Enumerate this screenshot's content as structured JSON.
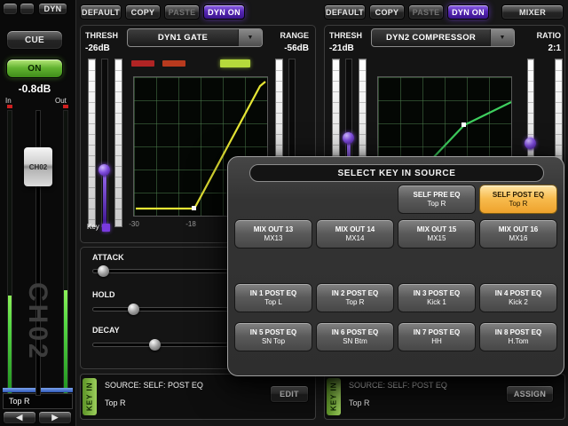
{
  "icons": {
    "prev": "◀",
    "next": "▶",
    "dropdown": "▼"
  },
  "colors": {
    "accent_purple": "#6a35c8",
    "on_green": "#5fae2e",
    "keyin_green": "#6fae35",
    "selected_orange": "#f2b94a",
    "channel_blue": "#4a78c8",
    "gate_curve": "#e6e635",
    "comp_curve": "#3ecf5e"
  },
  "channel": {
    "dyn_tab": "DYN",
    "cue": "CUE",
    "on": "ON",
    "level": "-0.8dB",
    "in_label": "In",
    "out_label": "Out",
    "fader_cap": "CH02",
    "name_vertical": "CH02",
    "patch": "Top R"
  },
  "dyn1": {
    "toolbar": {
      "default": "DEFAULT",
      "copy": "COPY",
      "paste": "PASTE",
      "dyn_on": "DYN ON"
    },
    "thresh_label": "THRESH",
    "thresh_value": "-26dB",
    "type": "DYN1 GATE",
    "range_label": "RANGE",
    "range_value": "-56dB",
    "axis_labels": [
      "-30",
      "-18"
    ],
    "key_label": "Key",
    "attack_label": "ATTACK",
    "hold_label": "HOLD",
    "decay_label": "DECAY",
    "keyin": {
      "tab": "KEY IN",
      "source": "SOURCE: SELF: POST EQ",
      "name": "Top R",
      "action": "EDIT"
    }
  },
  "dyn2": {
    "toolbar": {
      "default": "DEFAULT",
      "copy": "COPY",
      "paste": "PASTE",
      "dyn_on": "DYN ON",
      "mixer": "MIXER"
    },
    "thresh_label": "THRESH",
    "thresh_value": "-21dB",
    "type": "DYN2 COMPRESSOR",
    "ratio_label": "RATIO",
    "ratio_value": "2:1",
    "keyin": {
      "tab": "KEY IN",
      "source": "SOURCE: SELF: POST EQ",
      "name": "Top R",
      "action": "ASSIGN"
    }
  },
  "popup": {
    "title": "SELECT KEY IN SOURCE",
    "self_buttons": [
      {
        "l1": "SELF PRE EQ",
        "l2": "Top R",
        "selected": false
      },
      {
        "l1": "SELF POST EQ",
        "l2": "Top R",
        "selected": true
      }
    ],
    "mix_buttons": [
      {
        "l1": "MIX OUT 13",
        "l2": "MX13"
      },
      {
        "l1": "MIX OUT 14",
        "l2": "MX14"
      },
      {
        "l1": "MIX OUT 15",
        "l2": "MX15"
      },
      {
        "l1": "MIX OUT 16",
        "l2": "MX16"
      }
    ],
    "in_buttons": [
      {
        "l1": "IN 1 POST EQ",
        "l2": "Top L"
      },
      {
        "l1": "IN 2 POST EQ",
        "l2": "Top R"
      },
      {
        "l1": "IN 3 POST EQ",
        "l2": "Kick 1"
      },
      {
        "l1": "IN 4 POST EQ",
        "l2": "Kick 2"
      },
      {
        "l1": "IN 5 POST EQ",
        "l2": "SN Top"
      },
      {
        "l1": "IN 6 POST EQ",
        "l2": "SN Btm"
      },
      {
        "l1": "IN 7 POST EQ",
        "l2": "HH"
      },
      {
        "l1": "IN 8 POST EQ",
        "l2": "H.Tom"
      }
    ]
  }
}
